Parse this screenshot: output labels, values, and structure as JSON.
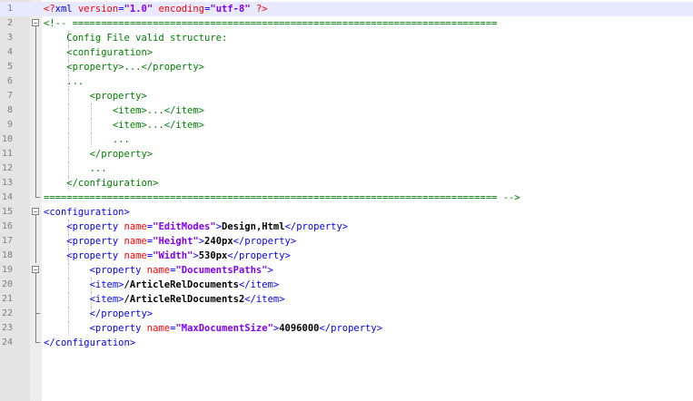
{
  "editor": {
    "language": "xml",
    "colors": {
      "tag": "#0000ff",
      "attr_name": "#ff0000",
      "attr_value": "#8000ff",
      "comment": "#008000",
      "prolog": "#ff0000",
      "line_number": "#808080",
      "current_line_bg": "#e8e8ff"
    },
    "lines": [
      {
        "n": "1",
        "tokens": [
          {
            "t": "<?",
            "c": "red"
          },
          {
            "t": "xml ",
            "c": "blue"
          },
          {
            "t": "version",
            "c": "red"
          },
          {
            "t": "=",
            "c": "blue"
          },
          {
            "t": "\"1.0\"",
            "c": "purple"
          },
          {
            "t": " ",
            "c": ""
          },
          {
            "t": "encoding",
            "c": "red"
          },
          {
            "t": "=",
            "c": "blue"
          },
          {
            "t": "\"utf-8\"",
            "c": "purple"
          },
          {
            "t": " ?>",
            "c": "red"
          }
        ]
      },
      {
        "n": "2",
        "tokens": [
          {
            "t": "<!-- ==========================================================================",
            "c": "green"
          }
        ]
      },
      {
        "n": "3",
        "tokens": [
          {
            "t": "    Config File valid structure:",
            "c": "green"
          }
        ]
      },
      {
        "n": "4",
        "tokens": [
          {
            "t": "    <configuration>",
            "c": "green"
          }
        ]
      },
      {
        "n": "5",
        "tokens": [
          {
            "t": "    <property>...</property>",
            "c": "green"
          }
        ]
      },
      {
        "n": "6",
        "tokens": [
          {
            "t": "    ...",
            "c": "green"
          }
        ]
      },
      {
        "n": "7",
        "tokens": [
          {
            "t": "        <property>",
            "c": "green"
          }
        ]
      },
      {
        "n": "8",
        "tokens": [
          {
            "t": "            <item>...</item>",
            "c": "green"
          }
        ]
      },
      {
        "n": "9",
        "tokens": [
          {
            "t": "            <item>...</item>",
            "c": "green"
          }
        ]
      },
      {
        "n": "10",
        "tokens": [
          {
            "t": "            ...",
            "c": "green"
          }
        ]
      },
      {
        "n": "11",
        "tokens": [
          {
            "t": "        </property>",
            "c": "green"
          }
        ]
      },
      {
        "n": "12",
        "tokens": [
          {
            "t": "        ...",
            "c": "green"
          }
        ]
      },
      {
        "n": "13",
        "tokens": [
          {
            "t": "    </configuration>",
            "c": "green"
          }
        ]
      },
      {
        "n": "14",
        "tokens": [
          {
            "t": "=============================================================================== -->",
            "c": "green"
          }
        ]
      },
      {
        "n": "15",
        "tokens": [
          {
            "t": "<configuration>",
            "c": "blue"
          }
        ]
      },
      {
        "n": "16",
        "tokens": [
          {
            "t": "    ",
            "c": ""
          },
          {
            "t": "<property ",
            "c": "blue"
          },
          {
            "t": "name",
            "c": "red"
          },
          {
            "t": "=",
            "c": "blue"
          },
          {
            "t": "\"EditModes\"",
            "c": "purple"
          },
          {
            "t": ">",
            "c": "blue"
          },
          {
            "t": "Design,Html",
            "c": "black-bold"
          },
          {
            "t": "</property>",
            "c": "blue"
          }
        ]
      },
      {
        "n": "17",
        "tokens": [
          {
            "t": "    ",
            "c": ""
          },
          {
            "t": "<property ",
            "c": "blue"
          },
          {
            "t": "name",
            "c": "red"
          },
          {
            "t": "=",
            "c": "blue"
          },
          {
            "t": "\"Height\"",
            "c": "purple"
          },
          {
            "t": ">",
            "c": "blue"
          },
          {
            "t": "240px",
            "c": "black-bold"
          },
          {
            "t": "</property>",
            "c": "blue"
          }
        ]
      },
      {
        "n": "18",
        "tokens": [
          {
            "t": "    ",
            "c": ""
          },
          {
            "t": "<property ",
            "c": "blue"
          },
          {
            "t": "name",
            "c": "red"
          },
          {
            "t": "=",
            "c": "blue"
          },
          {
            "t": "\"Width\"",
            "c": "purple"
          },
          {
            "t": ">",
            "c": "blue"
          },
          {
            "t": "530px",
            "c": "black-bold"
          },
          {
            "t": "</property>",
            "c": "blue"
          }
        ]
      },
      {
        "n": "19",
        "tokens": [
          {
            "t": "        ",
            "c": ""
          },
          {
            "t": "<property ",
            "c": "blue"
          },
          {
            "t": "name",
            "c": "red"
          },
          {
            "t": "=",
            "c": "blue"
          },
          {
            "t": "\"DocumentsPaths\"",
            "c": "purple"
          },
          {
            "t": ">",
            "c": "blue"
          }
        ]
      },
      {
        "n": "20",
        "tokens": [
          {
            "t": "        ",
            "c": ""
          },
          {
            "t": "<item>",
            "c": "blue"
          },
          {
            "t": "/ArticleRelDocuments",
            "c": "black-bold"
          },
          {
            "t": "</item>",
            "c": "blue"
          }
        ]
      },
      {
        "n": "21",
        "tokens": [
          {
            "t": "        ",
            "c": ""
          },
          {
            "t": "<item>",
            "c": "blue"
          },
          {
            "t": "/ArticleRelDocuments2",
            "c": "black-bold"
          },
          {
            "t": "</item>",
            "c": "blue"
          }
        ]
      },
      {
        "n": "22",
        "tokens": [
          {
            "t": "        ",
            "c": ""
          },
          {
            "t": "</property>",
            "c": "blue"
          }
        ]
      },
      {
        "n": "23",
        "tokens": [
          {
            "t": "        ",
            "c": ""
          },
          {
            "t": "<property ",
            "c": "blue"
          },
          {
            "t": "name",
            "c": "red"
          },
          {
            "t": "=",
            "c": "blue"
          },
          {
            "t": "\"MaxDocumentSize\"",
            "c": "purple"
          },
          {
            "t": ">",
            "c": "blue"
          },
          {
            "t": "4096000",
            "c": "black-bold"
          },
          {
            "t": "</property>",
            "c": "blue"
          }
        ]
      },
      {
        "n": "24",
        "tokens": [
          {
            "t": "</configuration>",
            "c": "blue"
          }
        ]
      }
    ]
  }
}
